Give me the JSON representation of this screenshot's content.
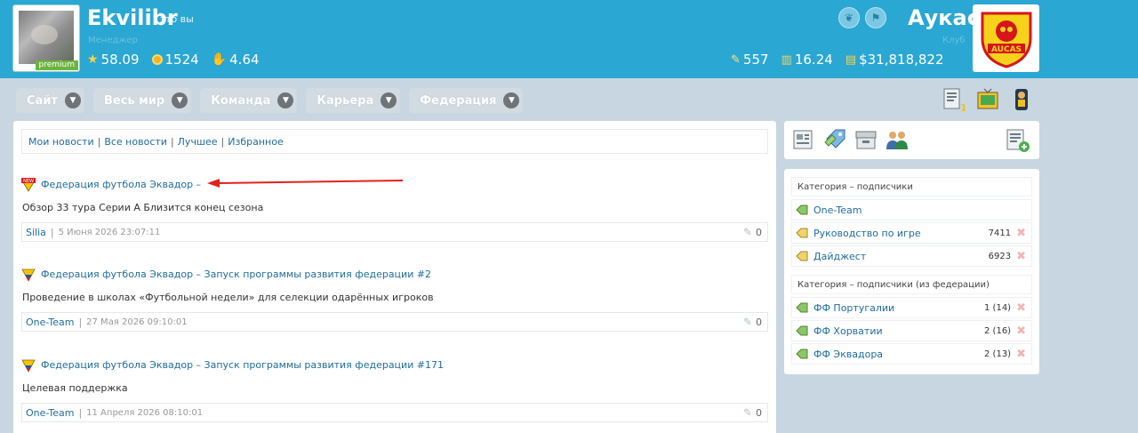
{
  "header": {
    "user_name": "Ekvilibr",
    "user_you": "это вы",
    "user_role": "Менеджер",
    "premium_label": "premium",
    "stats_left": [
      {
        "icon": "star-icon",
        "value": "58.09"
      },
      {
        "icon": "coin-icon",
        "value": "1524"
      },
      {
        "icon": "hand-icon",
        "value": "4.64"
      }
    ],
    "club_name": "Аукас",
    "club_role": "Клуб",
    "club_logo_text": "AUCAS",
    "stats_right": [
      {
        "icon": "tag-icon",
        "value": "557"
      },
      {
        "icon": "bars-icon",
        "value": "16.24"
      },
      {
        "icon": "money-icon",
        "value": "$31,818,822"
      }
    ]
  },
  "nav": {
    "items": [
      "Сайт",
      "Весь мир",
      "Команда",
      "Карьера",
      "Федерация"
    ],
    "tool_badge": "1"
  },
  "tabs": [
    "Мои новости",
    "Все новости",
    "Лучшее",
    "Избранное"
  ],
  "news": [
    {
      "title": "Федерация футбола Эквадор –",
      "desc": "Обзор 33 тура Серии А Близится конец сезона",
      "author": "Silia",
      "date": "5 Июня 2026 23:07:11",
      "comments": "0",
      "is_new": true
    },
    {
      "title": "Федерация футбола Эквадор – Запуск программы развития федерации #2",
      "desc": "Проведение в школах «Футбольной недели» для селекции одарённых игроков",
      "author": "One-Team",
      "date": "27 Мая 2026 09:10:01",
      "comments": "0",
      "is_new": false
    },
    {
      "title": "Федерация футбола Эквадор – Запуск программы развития федерации #171",
      "desc": "Целевая поддержка",
      "author": "One-Team",
      "date": "11 Апреля 2026 08:10:01",
      "comments": "0",
      "is_new": false
    }
  ],
  "sidebar": {
    "cat_head_1": "Категория – подписчики",
    "cats_1": [
      {
        "name": "One-Team",
        "count": "",
        "removable": false
      },
      {
        "name": "Руководство по игре",
        "count": "7411",
        "removable": true
      },
      {
        "name": "Дайджест",
        "count": "6923",
        "removable": true
      }
    ],
    "cat_head_2": "Категория – подписчики (из федерации)",
    "cats_2": [
      {
        "name": "ФФ Португалии",
        "count": "1 (14)",
        "removable": true
      },
      {
        "name": "ФФ Хорватии",
        "count": "2 (16)",
        "removable": true
      },
      {
        "name": "ФФ Эквадора",
        "count": "2 (13)",
        "removable": true
      }
    ]
  },
  "colors": {
    "header_bg": "#2aa7d3",
    "link": "#1f6c9e",
    "premium": "#6db33f",
    "arrow": "#e0231f"
  }
}
